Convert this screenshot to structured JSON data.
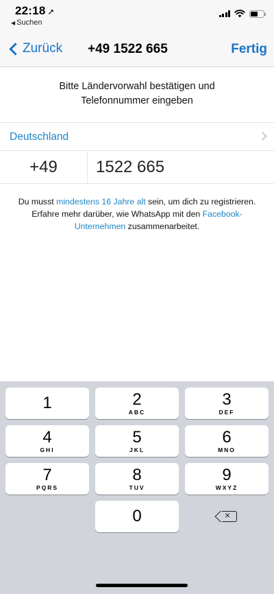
{
  "status_bar": {
    "time": "22:18",
    "back_app": "Suchen"
  },
  "nav": {
    "back_label": "Zurück",
    "title": "+49 1522 665",
    "done_label": "Fertig"
  },
  "instruction": {
    "line1": "Bitte Ländervorwahl bestätigen und",
    "line2": "Telefonnummer eingeben"
  },
  "country": {
    "name": "Deutschland"
  },
  "phone": {
    "code": "+49",
    "number": "1522 665"
  },
  "legal": {
    "part1": "Du musst ",
    "link1": "mindestens 16 Jahre alt",
    "part2": " sein, um dich zu registrieren. Erfahre mehr darüber, wie WhatsApp mit den ",
    "link2": "Facebook-Unternehmen",
    "part3": " zusammenarbeitet."
  },
  "keypad": {
    "keys": [
      {
        "digit": "1",
        "letters": ""
      },
      {
        "digit": "2",
        "letters": "ABC"
      },
      {
        "digit": "3",
        "letters": "DEF"
      },
      {
        "digit": "4",
        "letters": "GHI"
      },
      {
        "digit": "5",
        "letters": "JKL"
      },
      {
        "digit": "6",
        "letters": "MNO"
      },
      {
        "digit": "7",
        "letters": "PQRS"
      },
      {
        "digit": "8",
        "letters": "TUV"
      },
      {
        "digit": "9",
        "letters": "WXYZ"
      },
      {
        "digit": "0",
        "letters": ""
      }
    ]
  },
  "colors": {
    "accent": "#1a73c8",
    "link": "#1d84c6",
    "keypad_bg": "#d1d4db"
  }
}
